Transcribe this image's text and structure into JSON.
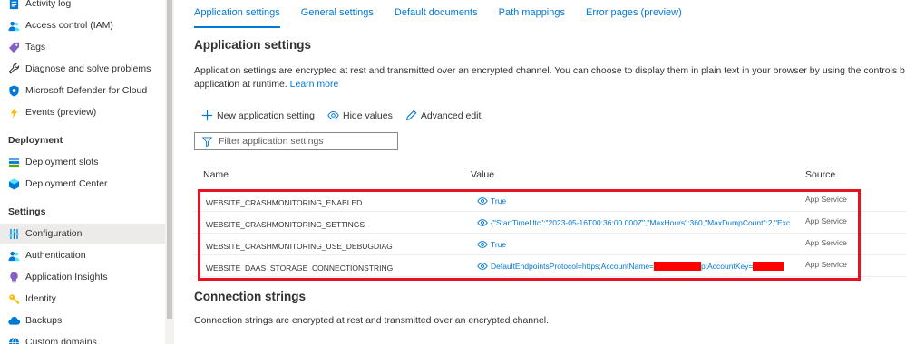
{
  "sidebar": {
    "items_top": [
      {
        "label": "Activity log",
        "icon": "activity-log-icon"
      },
      {
        "label": "Access control (IAM)",
        "icon": "people-icon"
      },
      {
        "label": "Tags",
        "icon": "tag-icon"
      },
      {
        "label": "Diagnose and solve problems",
        "icon": "wrench-icon"
      },
      {
        "label": "Microsoft Defender for Cloud",
        "icon": "shield-icon"
      },
      {
        "label": "Events (preview)",
        "icon": "lightning-icon"
      }
    ],
    "sections": [
      {
        "title": "Deployment",
        "items": [
          {
            "label": "Deployment slots",
            "icon": "slots-icon"
          },
          {
            "label": "Deployment Center",
            "icon": "cube-icon"
          }
        ]
      },
      {
        "title": "Settings",
        "items": [
          {
            "label": "Configuration",
            "icon": "sliders-icon",
            "active": true
          },
          {
            "label": "Authentication",
            "icon": "people-icon"
          },
          {
            "label": "Application Insights",
            "icon": "bulb-icon"
          },
          {
            "label": "Identity",
            "icon": "key-icon"
          },
          {
            "label": "Backups",
            "icon": "cloud-icon"
          },
          {
            "label": "Custom domains",
            "icon": "globe-icon"
          }
        ]
      }
    ]
  },
  "tabs": [
    {
      "label": "Application settings",
      "active": true
    },
    {
      "label": "General settings"
    },
    {
      "label": "Default documents"
    },
    {
      "label": "Path mappings"
    },
    {
      "label": "Error pages (preview)"
    }
  ],
  "app_settings": {
    "title": "Application settings",
    "description_line1": "Application settings are encrypted at rest and transmitted over an encrypted channel. You can choose to display them in plain text in your browser by using the controls b",
    "description_line2": "application at runtime.",
    "learn_more": "Learn more"
  },
  "toolbar": {
    "new_setting": "New application setting",
    "hide_values": "Hide values",
    "advanced_edit": "Advanced edit"
  },
  "filter": {
    "placeholder": "Filter application settings"
  },
  "table": {
    "headers": {
      "name": "Name",
      "value": "Value",
      "source": "Source"
    },
    "rows": [
      {
        "name": "WEBSITE_CRASHMONITORING_ENABLED",
        "value": "True",
        "source": "App Service"
      },
      {
        "name": "WEBSITE_CRASHMONITORING_SETTINGS",
        "value": "{\"StartTimeUtc\":\"2023-05-16T00:36:00.000Z\",\"MaxHours\":360,\"MaxDumpCount\":2,\"Exc",
        "source": "App Service"
      },
      {
        "name": "WEBSITE_CRASHMONITORING_USE_DEBUGDIAG",
        "value": "True",
        "source": "App Service"
      },
      {
        "name": "WEBSITE_DAAS_STORAGE_CONNECTIONSTRING",
        "value_prefix": "DefaultEndpointsProtocol=https;AccountName=",
        "value_middle": "p;AccountKey=",
        "source": "App Service"
      }
    ]
  },
  "connection_strings": {
    "title": "Connection strings",
    "description": "Connection strings are encrypted at rest and transmitted over an encrypted channel."
  },
  "colors": {
    "accent": "#0078d4",
    "highlight": "#e81123",
    "redaction": "#ff0000",
    "active_nav_bg": "#edebe9"
  }
}
